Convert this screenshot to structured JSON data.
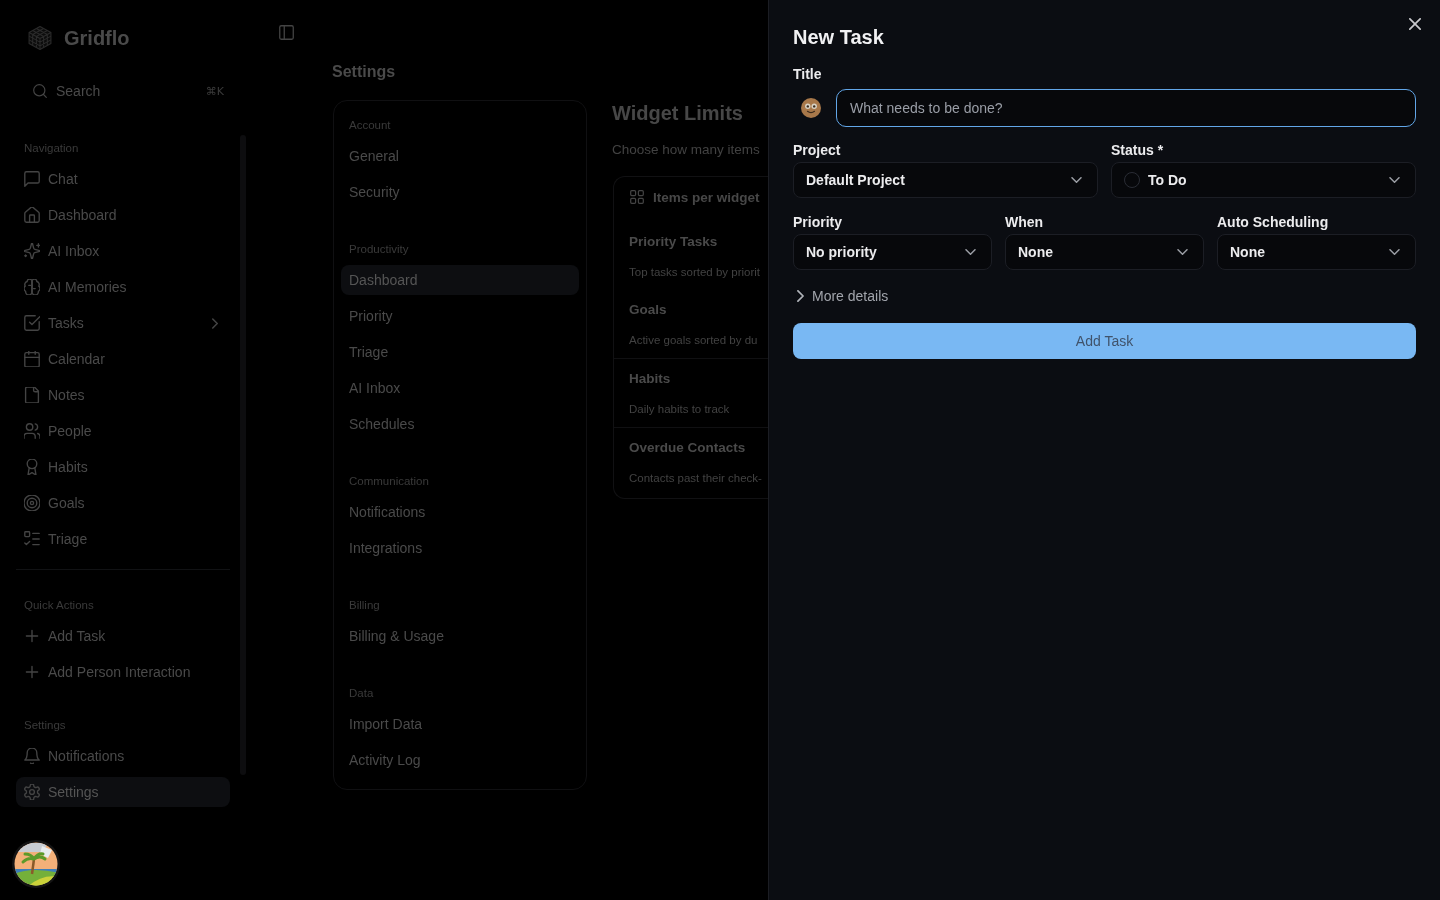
{
  "sidebar": {
    "brand": "Gridflo",
    "search": {
      "placeholder": "Search",
      "shortcut": "⌘K"
    },
    "sections": [
      {
        "label": "Navigation",
        "items": [
          {
            "label": "Chat",
            "kind": "link",
            "selected": false
          },
          {
            "label": "Dashboard",
            "kind": "link",
            "selected": false
          },
          {
            "label": "AI Inbox",
            "kind": "link",
            "selected": false
          },
          {
            "label": "AI Memories",
            "kind": "link",
            "selected": false
          },
          {
            "label": "Tasks",
            "kind": "submenu",
            "selected": false
          },
          {
            "label": "Calendar",
            "kind": "link",
            "selected": false
          },
          {
            "label": "Notes",
            "kind": "link",
            "selected": false
          },
          {
            "label": "People",
            "kind": "link",
            "selected": false
          },
          {
            "label": "Habits",
            "kind": "link",
            "selected": false
          },
          {
            "label": "Goals",
            "kind": "link",
            "selected": false
          },
          {
            "label": "Triage",
            "kind": "link",
            "selected": false
          }
        ]
      },
      {
        "label": "Quick Actions",
        "items": [
          {
            "label": "Add Task",
            "kind": "action"
          },
          {
            "label": "Add Person Interaction",
            "kind": "action"
          }
        ]
      },
      {
        "label": "Settings",
        "items": [
          {
            "label": "Notifications",
            "kind": "link",
            "selected": false
          },
          {
            "label": "Settings",
            "kind": "link",
            "selected": true
          }
        ]
      }
    ]
  },
  "page": {
    "title": "Settings",
    "nav": [
      {
        "label": "Account",
        "items": [
          {
            "label": "General",
            "selected": false
          },
          {
            "label": "Security",
            "selected": false
          }
        ]
      },
      {
        "label": "Productivity",
        "items": [
          {
            "label": "Dashboard",
            "selected": true
          },
          {
            "label": "Priority",
            "selected": false
          },
          {
            "label": "Triage",
            "selected": false
          },
          {
            "label": "AI Inbox",
            "selected": false
          },
          {
            "label": "Schedules",
            "selected": false
          }
        ]
      },
      {
        "label": "Communication",
        "items": [
          {
            "label": "Notifications",
            "selected": false
          },
          {
            "label": "Integrations",
            "selected": false
          }
        ]
      },
      {
        "label": "Billing",
        "items": [
          {
            "label": "Billing & Usage",
            "selected": false
          }
        ]
      },
      {
        "label": "Data",
        "items": [
          {
            "label": "Import Data",
            "selected": false
          },
          {
            "label": "Activity Log",
            "selected": false
          }
        ]
      }
    ],
    "content": {
      "title": "Widget Limits",
      "subtitle": "Choose how many items",
      "card": {
        "title": "Items per widget",
        "rows": [
          {
            "name": "Priority Tasks",
            "description": "Top tasks sorted by priorit"
          },
          {
            "name": "Goals",
            "description": "Active goals sorted by du"
          },
          {
            "name": "Habits",
            "description": "Daily habits to track"
          },
          {
            "name": "Overdue Contacts",
            "description": "Contacts past their check-"
          }
        ]
      }
    }
  },
  "sheet": {
    "title": "New Task",
    "title_field": {
      "label": "Title",
      "placeholder": "What needs to be done?",
      "focused": true
    },
    "field_rows": [
      [
        {
          "label": "Project",
          "value": "Default Project",
          "kind": "select"
        },
        {
          "label": "Status *",
          "value": "To Do",
          "kind": "status"
        }
      ],
      [
        {
          "label": "Priority",
          "value": "No priority",
          "kind": "select"
        },
        {
          "label": "When",
          "value": "None",
          "kind": "select"
        },
        {
          "label": "Auto Scheduling",
          "value": "None",
          "kind": "select"
        }
      ]
    ],
    "more_details": {
      "label": "More details",
      "expanded": false
    },
    "submit": "Add Task"
  }
}
